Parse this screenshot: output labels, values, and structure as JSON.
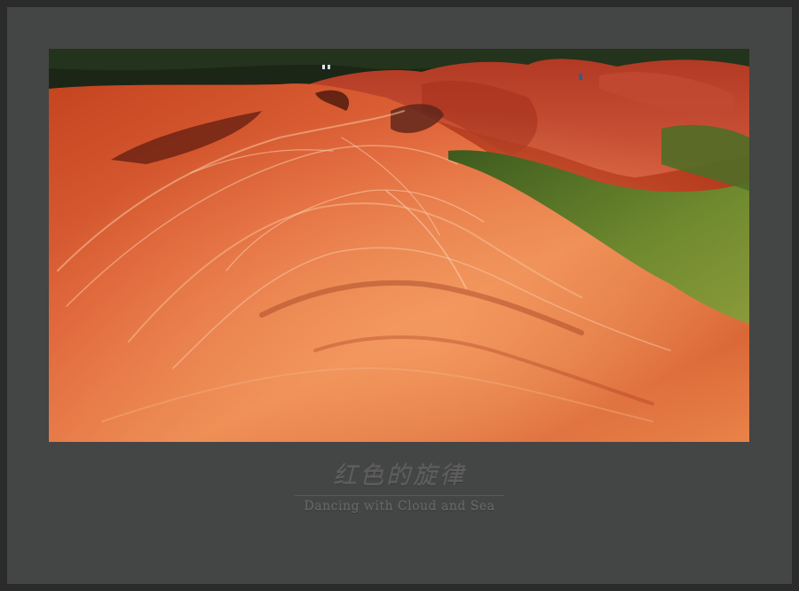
{
  "caption": {
    "title_zh": "红色的旋律",
    "title_en": "Dancing with Cloud and Sea"
  },
  "photo": {
    "subject": "red-sandstone-landscape",
    "colors": {
      "rock_light": "#f08a4a",
      "rock_mid": "#d9552a",
      "rock_dark": "#8f2a16",
      "grass": "#5d7a2a",
      "treeline": "#1c2616"
    }
  }
}
